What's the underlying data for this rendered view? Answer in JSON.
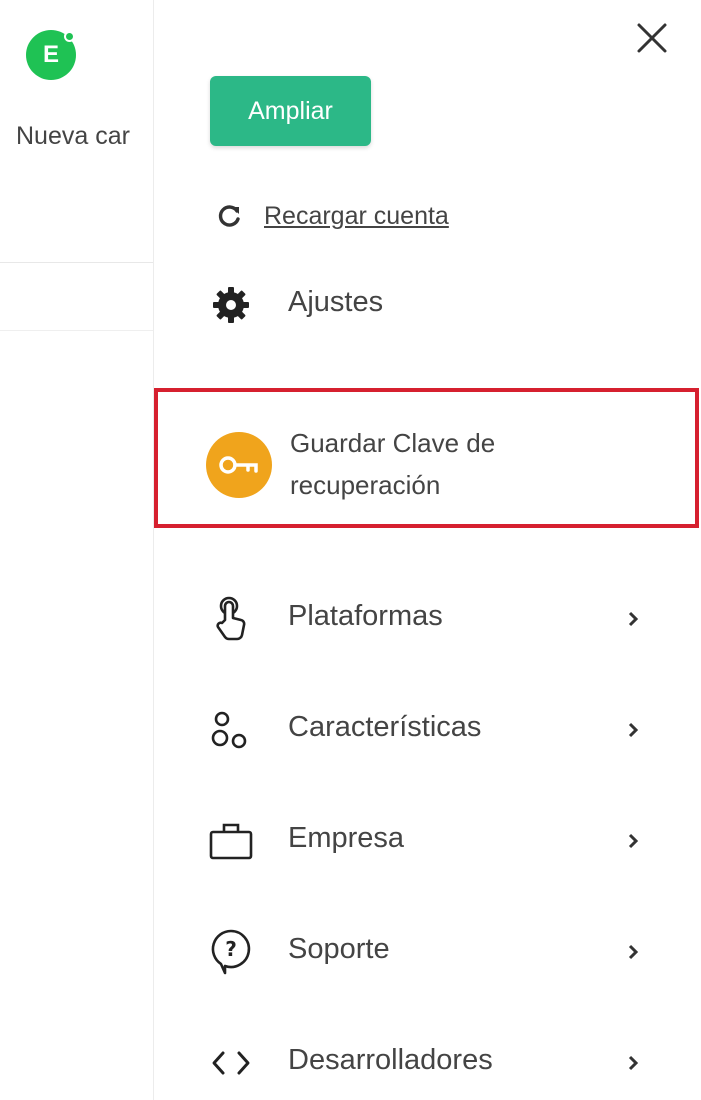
{
  "background_page": {
    "avatar_letter": "E",
    "label": "Nueva car"
  },
  "drawer": {
    "close_icon": "close-icon",
    "expand_button": "Ampliar",
    "reload_link": "Recargar cuenta",
    "settings": "Ajustes",
    "recovery_key": {
      "line1": "Guardar Clave de",
      "line2": "recuperación",
      "icon": "key-icon"
    },
    "menu": [
      {
        "label": "Plataformas",
        "icon": "touch-hand-icon"
      },
      {
        "label": "Características",
        "icon": "features-icon"
      },
      {
        "label": "Empresa",
        "icon": "briefcase-icon"
      },
      {
        "label": "Soporte",
        "icon": "help-bubble-icon"
      },
      {
        "label": "Desarrolladores",
        "icon": "code-icon"
      }
    ]
  },
  "colors": {
    "expand_button": "#2cb887",
    "avatar": "#1fc254",
    "key_circle": "#f0a41c",
    "highlight_border": "#d6202f"
  }
}
